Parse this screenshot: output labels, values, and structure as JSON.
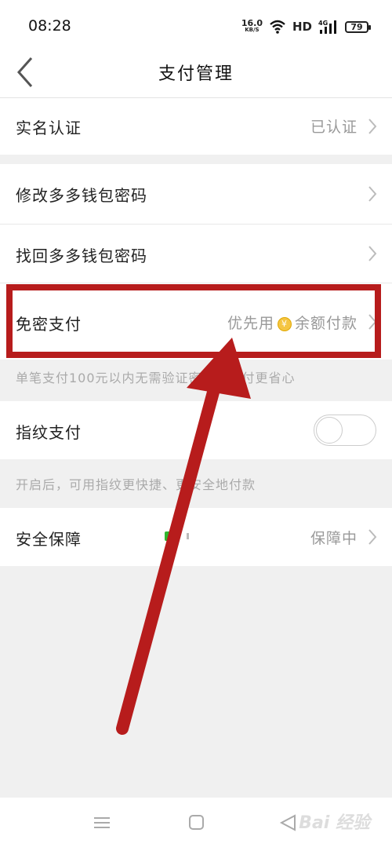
{
  "status_bar": {
    "time": "08:28",
    "net_speed": "16.0",
    "net_unit": "KB/S",
    "hd": "HD",
    "signal": "4G",
    "battery": "79"
  },
  "header": {
    "title": "支付管理",
    "back_icon": "chevron-left-icon"
  },
  "rows": {
    "realname": {
      "label": "实名认证",
      "value": "已认证"
    },
    "change_password": {
      "label": "修改多多钱包密码"
    },
    "recover_password": {
      "label": "找回多多钱包密码"
    },
    "nopwd_pay": {
      "label": "免密支付",
      "value_prefix": "优先用",
      "coin_symbol": "¥",
      "value_suffix": "余额付款"
    },
    "nopwd_hint": "单笔支付100元以内无需验证密码，支付更省心",
    "fingerprint": {
      "label": "指纹支付",
      "toggle_on": false
    },
    "fingerprint_hint": "开启后，可用指纹更快捷、更安全地付款",
    "security": {
      "label": "安全保障",
      "value": "保障中"
    }
  },
  "system_nav": {
    "menu_icon": "menu-icon",
    "home_icon": "home-square-icon",
    "back_icon": "back-triangle-icon"
  },
  "watermark": "Bai 经验",
  "colors": {
    "annotation": "#b71c1c",
    "coin": "#f5c542",
    "muted_text": "#999999"
  }
}
